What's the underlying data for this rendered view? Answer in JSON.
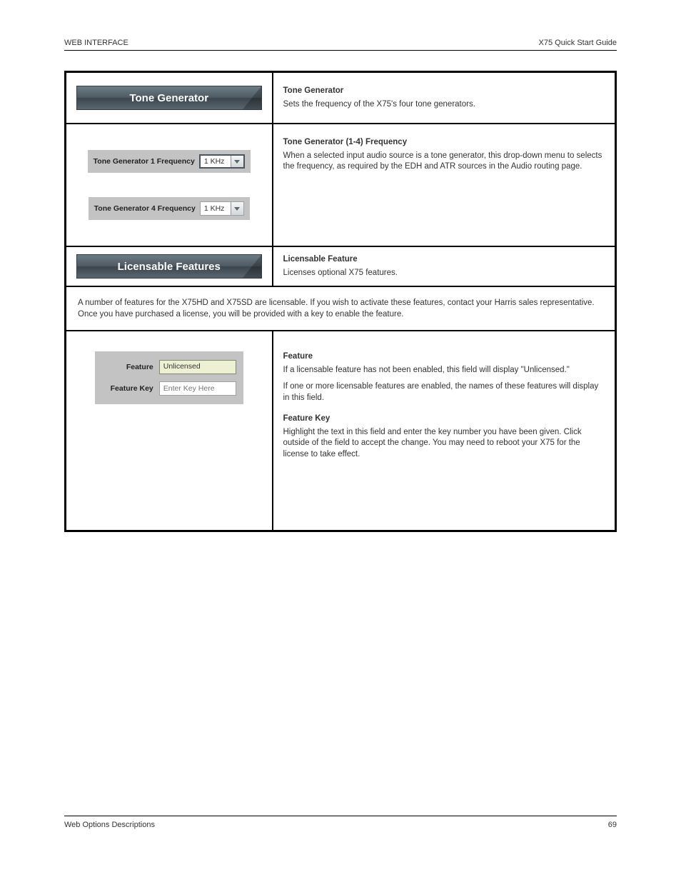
{
  "header": {
    "left": "WEB INTERFACE",
    "right": "X75 Quick Start Guide"
  },
  "rows": {
    "tone_header": {
      "banner": "Tone Generator",
      "right_heading": "Tone Generator",
      "right_body": "Sets the frequency of the X75's four tone generators."
    },
    "tone_controls": {
      "ctrl1_label": "Tone Generator 1 Frequency",
      "ctrl1_value": "1 KHz",
      "ctrl2_label": "Tone Generator 4 Frequency",
      "ctrl2_value": "1 KHz",
      "right_heading": "Tone Generator (1-4) Frequency",
      "right_body": "When a selected input audio source is a tone generator, this drop-down menu to selects the frequency, as required by the EDH and ATR sources in the Audio routing page."
    },
    "lic_header": {
      "banner": "Licensable Features",
      "right_heading": "Licensable Feature",
      "right_body": "Licenses optional X75 features."
    },
    "lic_intro": {
      "body": "A number of features for the X75HD and X75SD are licensable. If you wish to activate these features, contact your Harris sales representative. Once you have purchased a license, you will be provided with a key to enable the feature."
    },
    "lic_controls": {
      "feature_lbl": "Feature",
      "feature_val": "Unlicensed",
      "key_lbl": "Feature Key",
      "key_placeholder": "Enter Key Here",
      "right_heading": "Feature",
      "right_body1": "If a licensable feature has not been enabled, this field will display \"Unlicensed.\"",
      "right_body2": "If one or more licensable features are enabled, the names of these features will display in this field.",
      "right_heading2": "Feature Key",
      "right_body3": "Highlight the text in this field and enter the key number you have been given. Click outside of the field to accept the change. You may need to reboot your X75 for the license to take effect."
    }
  },
  "footer": {
    "left": "Web Options Descriptions",
    "right": "69"
  }
}
